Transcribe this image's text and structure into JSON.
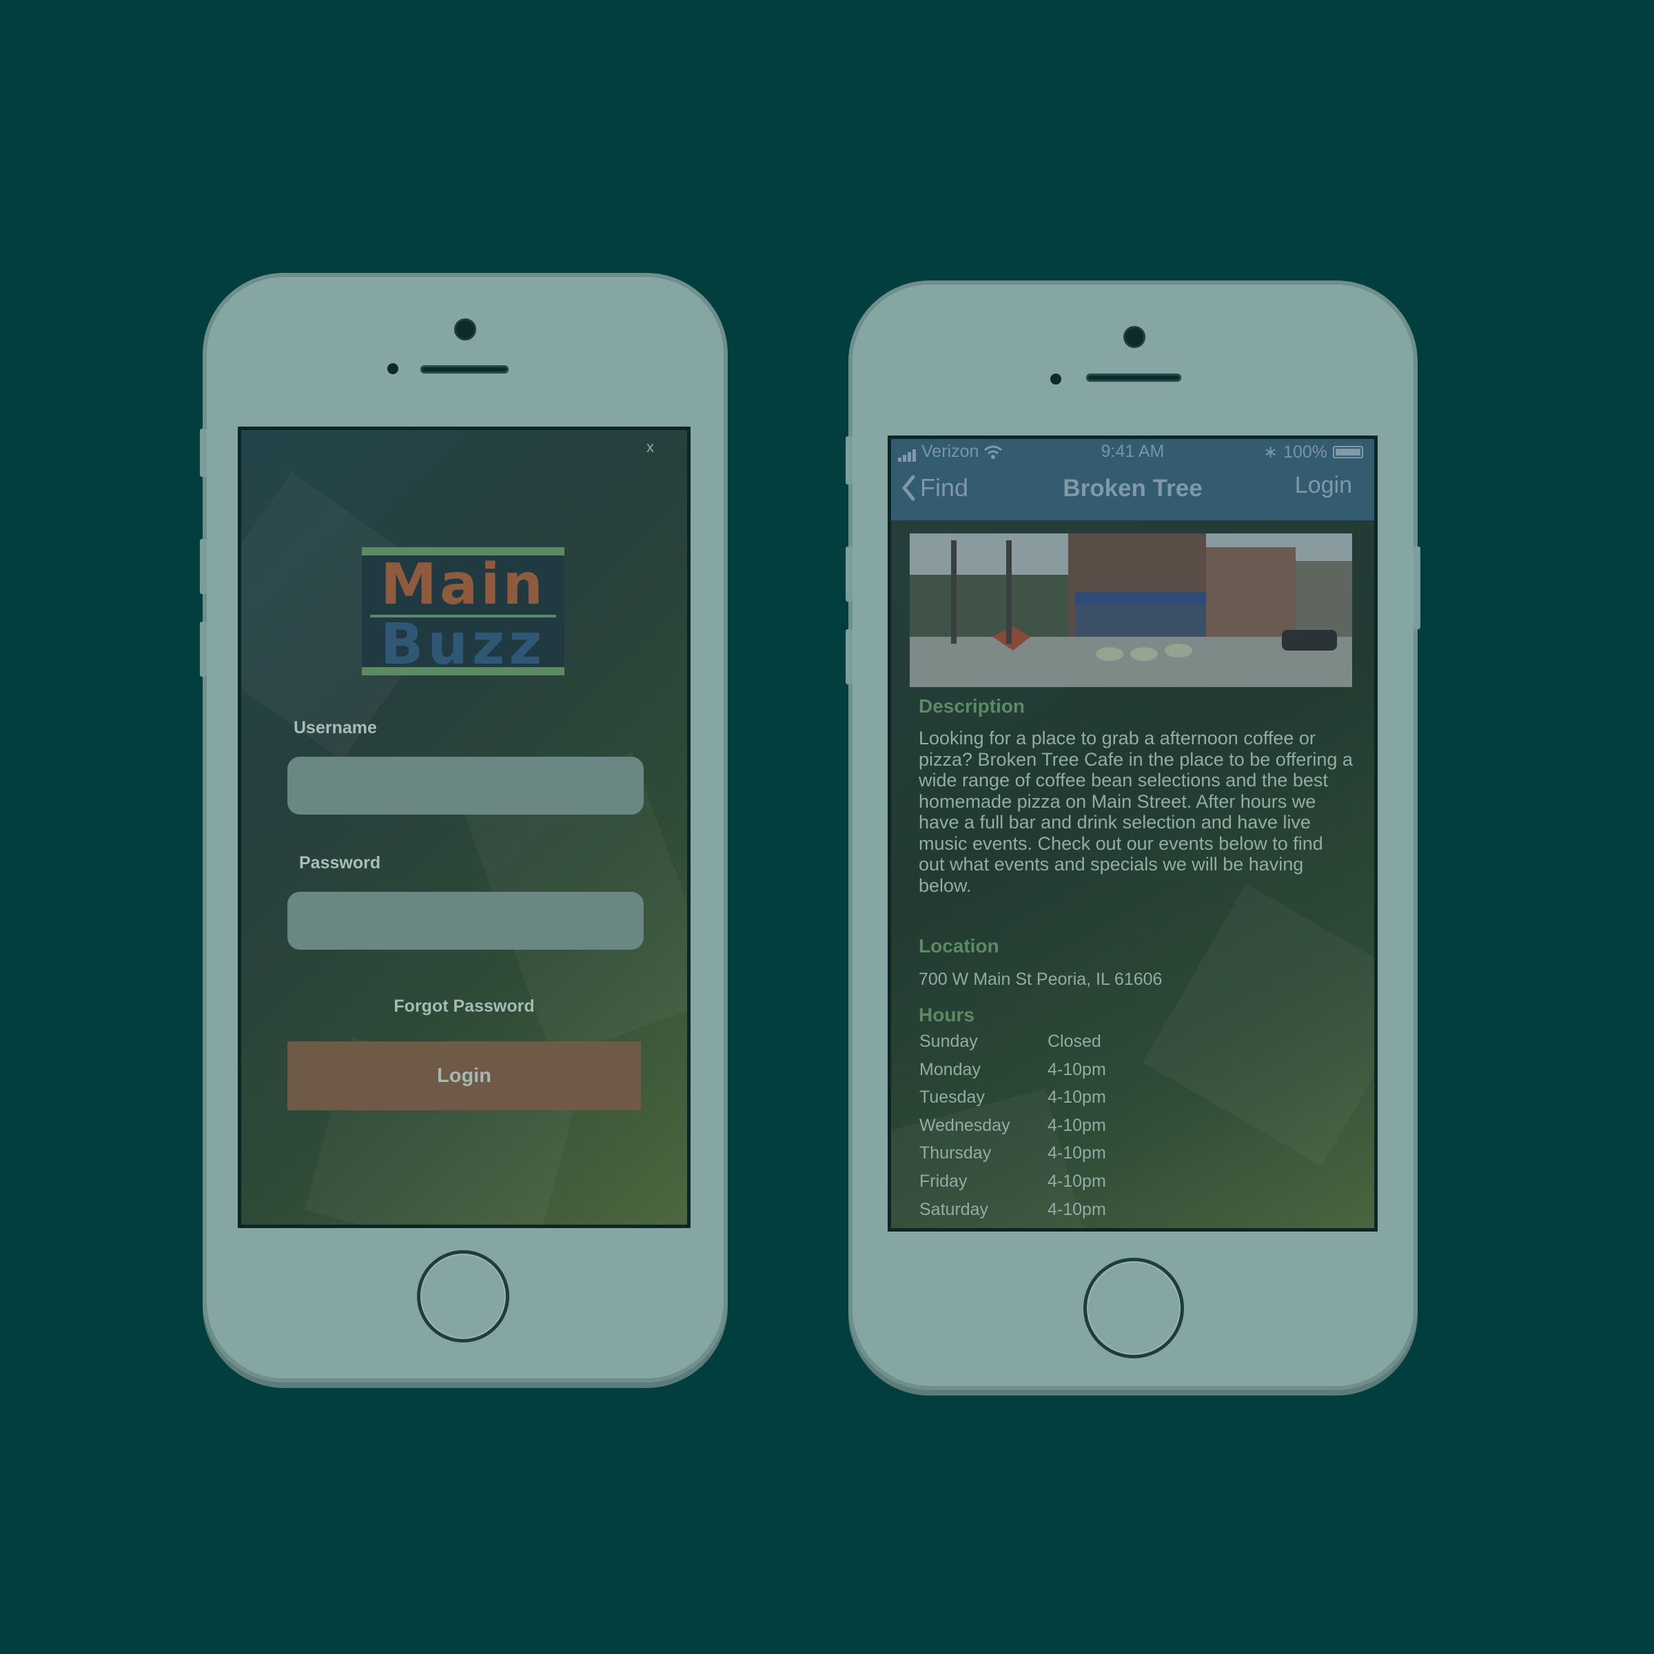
{
  "colors": {
    "background": "#023e3d",
    "phone_body": "#86a6a3",
    "logo_main": "#8f5b3f",
    "logo_buzz": "#2f5876",
    "accent_green": "#5c8a63",
    "login_button": "#6e5a46",
    "nav_bar": "#345c70"
  },
  "login_screen": {
    "close_label": "x",
    "logo": {
      "line1": "Main",
      "line2": "Buzz"
    },
    "username_label": "Username",
    "username_value": "",
    "password_label": "Password",
    "password_value": "",
    "forgot_password": "Forgot Password",
    "login_button": "Login"
  },
  "detail_screen": {
    "status_bar": {
      "carrier": "Verizon",
      "time": "9:41 AM",
      "battery": "100%"
    },
    "nav": {
      "back_label": "Find",
      "title": "Broken Tree",
      "action": "Login"
    },
    "photo_icon": "storefront-photo",
    "description_title": "Description",
    "description": "Looking for a place to grab a afternoon coffee or pizza? Broken Tree Cafe in the place to be offering a wide range of coffee bean selections and the best homemade pizza on Main Street. After hours we have a full bar and drink selection and have live music events. Check out our events below to find out what events and specials we will be having below.",
    "location_title": "Location",
    "location": "700 W Main St Peoria, IL 61606",
    "hours_title": "Hours",
    "hours": [
      {
        "day": "Sunday",
        "time": "Closed"
      },
      {
        "day": "Monday",
        "time": "4-10pm"
      },
      {
        "day": "Tuesday",
        "time": "4-10pm"
      },
      {
        "day": "Wednesday",
        "time": "4-10pm"
      },
      {
        "day": "Thursday",
        "time": "4-10pm"
      },
      {
        "day": "Friday",
        "time": "4-10pm"
      },
      {
        "day": "Saturday",
        "time": "4-10pm"
      }
    ]
  }
}
